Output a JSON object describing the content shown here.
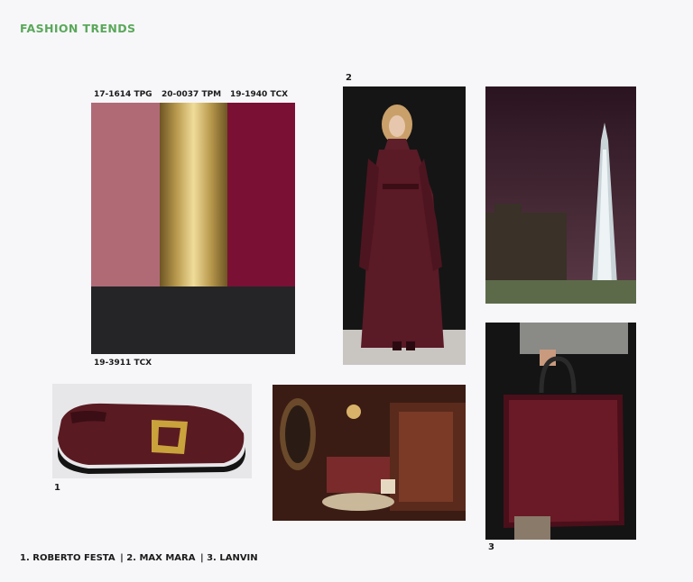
{
  "header": {
    "title": "FASHION TRENDS",
    "title_color": "#5aa85a"
  },
  "palette": {
    "swatches": [
      {
        "code": "17-1614 TPG",
        "color": "#b06a76"
      },
      {
        "code": "20-0037 TPM",
        "color": "#b99a4e"
      },
      {
        "code": "19-1940 TCX",
        "color": "#7a1134"
      },
      {
        "code": "19-3911 TCX",
        "color": "#252528"
      }
    ]
  },
  "photos": {
    "loafer": {
      "number": "1"
    },
    "coat": {
      "number": "2"
    },
    "bag": {
      "number": "3"
    }
  },
  "credits": {
    "items": [
      "1. ROBERTO FESTA",
      "| 2. MAX MARA",
      "| 3. LANVIN"
    ]
  }
}
